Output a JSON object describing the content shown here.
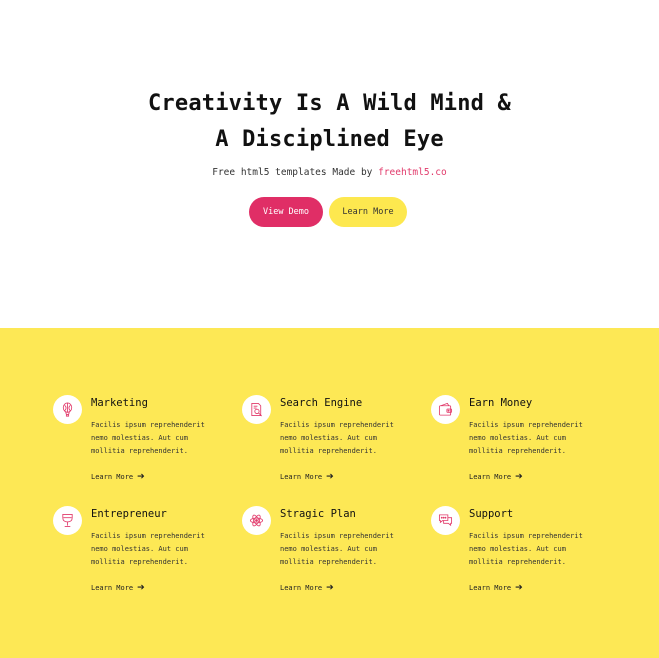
{
  "hero": {
    "title_line1": "Creativity Is A Wild Mind &",
    "title_line2": "A Disciplined Eye",
    "subtitle_prefix": "Free html5 templates Made by ",
    "subtitle_link": "freehtml5.co",
    "view_demo_label": "View Demo",
    "learn_more_label": "Learn More"
  },
  "features": [
    {
      "title": "Marketing",
      "icon": "balloon-icon",
      "text": "Facilis ipsum reprehenderit nemo molestias. Aut cum mollitia reprehenderit.",
      "link": "Learn More"
    },
    {
      "title": "Search Engine",
      "icon": "search-document-icon",
      "text": "Facilis ipsum reprehenderit nemo molestias. Aut cum mollitia reprehenderit.",
      "link": "Learn More"
    },
    {
      "title": "Earn Money",
      "icon": "wallet-icon",
      "text": "Facilis ipsum reprehenderit nemo molestias. Aut cum mollitia reprehenderit.",
      "link": "Learn More"
    },
    {
      "title": "Entrepreneur",
      "icon": "wine-glass-icon",
      "text": "Facilis ipsum reprehenderit nemo molestias. Aut cum mollitia reprehenderit.",
      "link": "Learn More"
    },
    {
      "title": "Stragic Plan",
      "icon": "atom-icon",
      "text": "Facilis ipsum reprehenderit nemo molestias. Aut cum mollitia reprehenderit.",
      "link": "Learn More"
    },
    {
      "title": "Support",
      "icon": "chat-bubbles-icon",
      "text": "Facilis ipsum reprehenderit nemo molestias. Aut cum mollitia reprehenderit.",
      "link": "Learn More"
    }
  ],
  "colors": {
    "accent_pink": "#e02e66",
    "accent_yellow": "#fde855"
  }
}
